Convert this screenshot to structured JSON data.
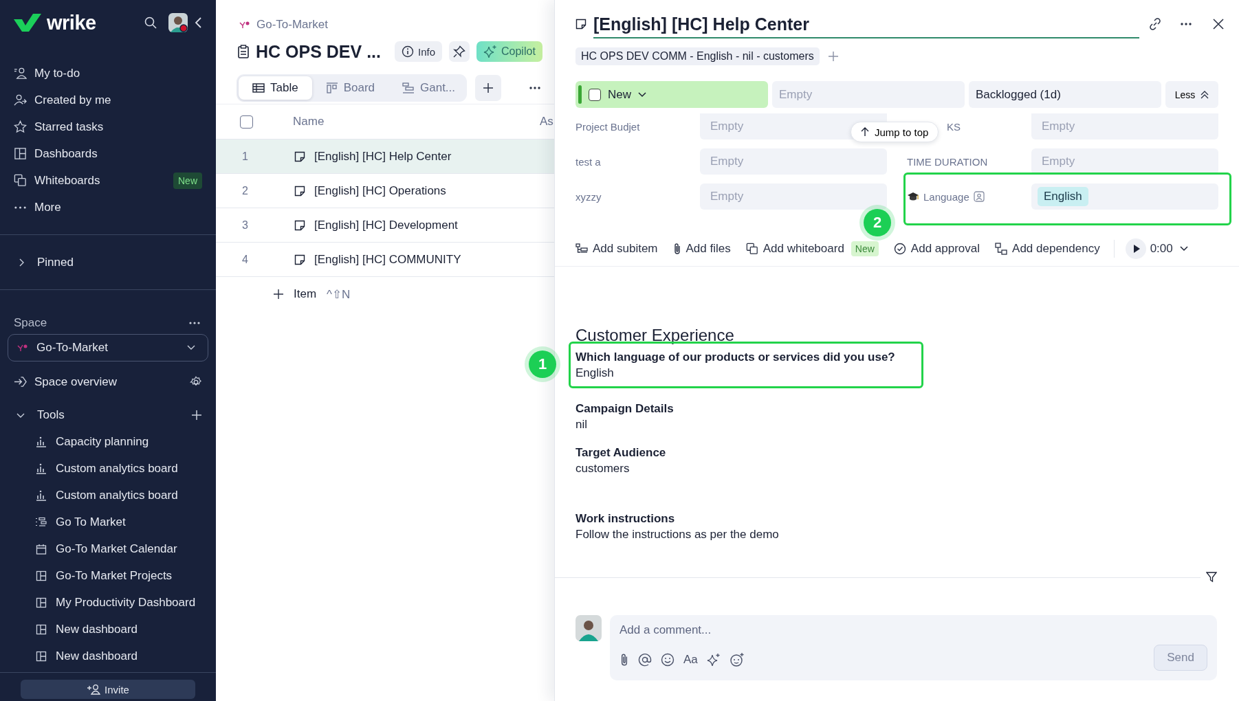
{
  "sidebar": {
    "logo": "wrike",
    "nav": [
      {
        "label": "My to-do",
        "kind": "todo"
      },
      {
        "label": "Created by me",
        "kind": "created"
      },
      {
        "label": "Starred tasks",
        "kind": "star"
      },
      {
        "label": "Dashboards",
        "kind": "dashboard"
      },
      {
        "label": "Whiteboards",
        "kind": "whiteboard",
        "badge": "New"
      },
      {
        "label": "More",
        "kind": "more"
      }
    ],
    "pinned": {
      "label": "Pinned",
      "expanded": false
    },
    "space_label": "Space",
    "space": "Go-To-Market",
    "space_overview": "Space overview",
    "tools": {
      "label": "Tools",
      "expanded": true,
      "items": [
        {
          "label": "Capacity planning",
          "kind": "analytics"
        },
        {
          "label": "Custom analytics board",
          "kind": "analytics"
        },
        {
          "label": "Custom analytics board",
          "kind": "analytics"
        },
        {
          "label": "Go To Market",
          "kind": "gantt"
        },
        {
          "label": "Go-To Market Calendar",
          "kind": "calendar"
        },
        {
          "label": "Go-To Market Projects",
          "kind": "dashboard"
        },
        {
          "label": "My Productivity Dashboard",
          "kind": "dashboard"
        },
        {
          "label": "New dashboard",
          "kind": "dashboard"
        },
        {
          "label": "New dashboard",
          "kind": "dashboard"
        }
      ]
    },
    "invite": "Invite"
  },
  "project": {
    "breadcrumb": "Go-To-Market",
    "title": "HC OPS DEV ...",
    "info": "Info",
    "copilot": "Copilot",
    "views": [
      {
        "label": "Table",
        "kind": "table",
        "selected": true
      },
      {
        "label": "Board",
        "kind": "board",
        "selected": false
      },
      {
        "label": "Gant...",
        "kind": "gantt",
        "selected": false
      }
    ],
    "table": {
      "all_checked": false,
      "columns": [
        "Name",
        "As"
      ],
      "rows": [
        {
          "number": "1",
          "name": "[English] [HC] Help Center",
          "selected": true
        },
        {
          "number": "2",
          "name": "[English] [HC] Operations",
          "selected": false
        },
        {
          "number": "3",
          "name": "[English] [HC] Development",
          "selected": false
        },
        {
          "number": "4",
          "name": "[English] [HC] COMMUNITY",
          "selected": false
        }
      ]
    },
    "add_item": "Item",
    "shortcut": "^⇧N"
  },
  "task": {
    "title": "[English] [HC] Help Center",
    "tag": "HC OPS DEV COMM - English - nil - customers",
    "status": "New",
    "status_checked": false,
    "assignee": {
      "placeholder": "Empty"
    },
    "state": "Backlogged (1d)",
    "less": "Less",
    "fields": [
      {
        "left": {
          "label": "Project Budjet",
          "placeholder": "Empty"
        },
        "right": {
          "label": "KS",
          "placeholder": "Empty",
          "highlighted": false
        }
      },
      {
        "left": {
          "label": "test a",
          "placeholder": "Empty"
        },
        "right": {
          "label": "TIME DURATION",
          "placeholder": "Empty",
          "highlighted": false
        }
      },
      {
        "left": {
          "label": "xyzzy",
          "placeholder": "Empty"
        },
        "right": {
          "label": "Language",
          "value": "English",
          "kind": "tag",
          "highlighted": true,
          "annotation": "2"
        }
      }
    ],
    "jump": "Jump to top",
    "actions": [
      {
        "label": "Add subitem",
        "kind": "subitem"
      },
      {
        "label": "Add files",
        "kind": "files"
      },
      {
        "label": "Add whiteboard",
        "kind": "whiteboard",
        "badge": "New"
      },
      {
        "label": "Add approval",
        "kind": "approval"
      },
      {
        "label": "Add dependency",
        "kind": "dependency"
      }
    ],
    "timer": "0:00",
    "section": "Customer Experience",
    "details": [
      {
        "label": "Which language of our products or services did you use?",
        "value": "English",
        "highlighted": true,
        "annotation": "1"
      },
      {
        "label": "Campaign Details",
        "value": "nil",
        "highlighted": false
      },
      {
        "label": "Target Audience",
        "value": "customers",
        "highlighted": false
      },
      {
        "label": "Work instructions",
        "value": "Follow the instructions as per the demo",
        "highlighted": false
      }
    ],
    "comment": {
      "placeholder": "Add a comment...",
      "format": "Aa",
      "send": "Send"
    }
  }
}
